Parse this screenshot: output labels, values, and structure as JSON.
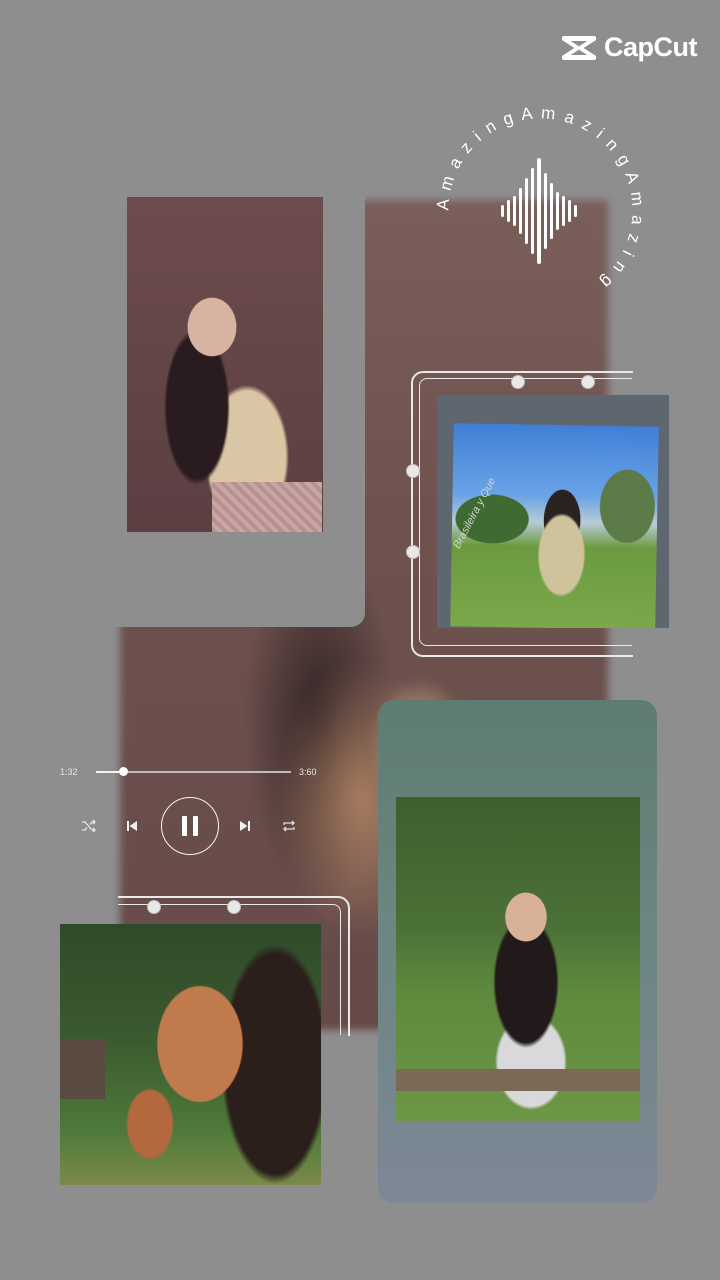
{
  "brand": {
    "name": "CapCut"
  },
  "badge": {
    "text": "A m a z i n g A m a z i n g A m a z i n g"
  },
  "player": {
    "elapsed": "1:32",
    "duration": "3:60",
    "progress": 0.14,
    "is_playing": true
  },
  "photos": [
    {
      "caption": "Brasileira y Que"
    }
  ],
  "icons": [
    "capcut-logo-icon",
    "soundwave-icon",
    "shuffle-icon",
    "previous-icon",
    "pause-icon",
    "next-icon",
    "repeat-icon"
  ]
}
